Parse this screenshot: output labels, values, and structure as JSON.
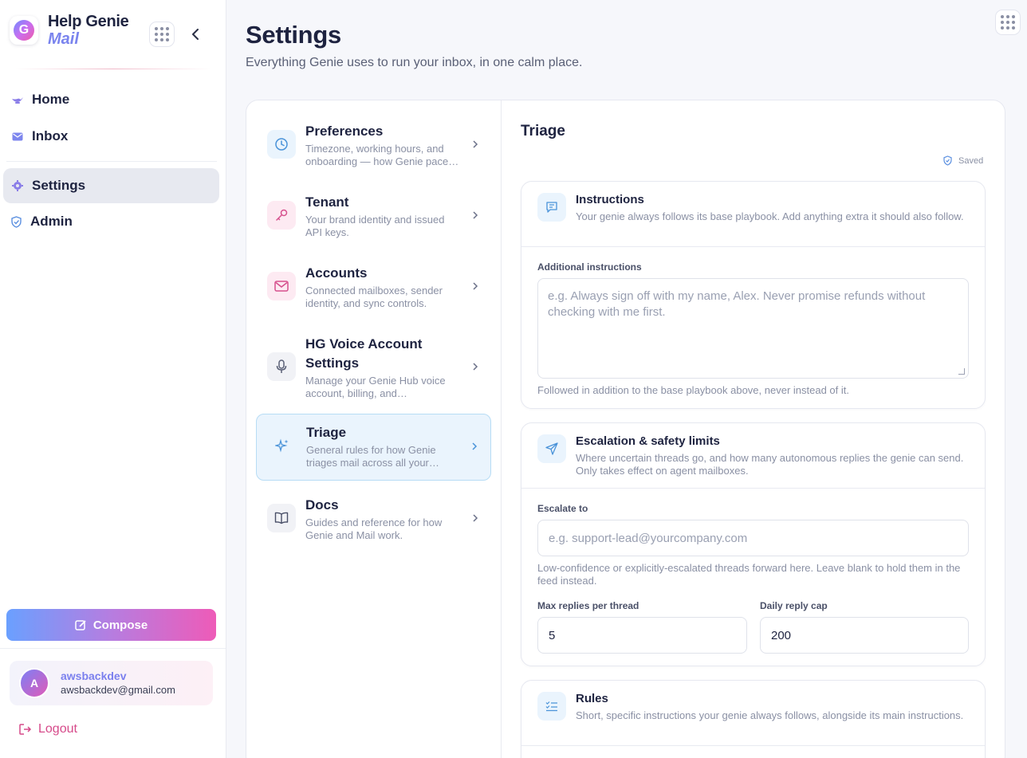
{
  "brand": {
    "name": "Help Genie",
    "sub": "Mail",
    "logo_letter": "G"
  },
  "nav": [
    {
      "label": "Home",
      "icon": "lamp-icon"
    },
    {
      "label": "Inbox",
      "icon": "mail-icon"
    },
    {
      "label": "Settings",
      "icon": "gear-icon",
      "active": true
    },
    {
      "label": "Admin",
      "icon": "shield-icon"
    }
  ],
  "compose_label": "Compose",
  "user": {
    "initial": "A",
    "name": "awsbackdev",
    "email": "awsbackdev@gmail.com"
  },
  "logout_label": "Logout",
  "page": {
    "title": "Settings",
    "subtitle": "Everything Genie uses to run your inbox, in one calm place."
  },
  "menu": [
    {
      "title": "Preferences",
      "desc": "Timezone, working hours, and onboarding — how Genie pace…",
      "icon": "clock-icon"
    },
    {
      "title": "Tenant",
      "desc": "Your brand identity and issued API keys.",
      "icon": "key-icon"
    },
    {
      "title": "Accounts",
      "desc": "Connected mailboxes, sender identity, and sync controls.",
      "icon": "mail-icon"
    },
    {
      "title": "HG Voice Account Settings",
      "desc": "Manage your Genie Hub voice account, billing, and…",
      "icon": "microphone-icon"
    },
    {
      "title": "Triage",
      "desc": "General rules for how Genie triages mail across all your…",
      "icon": "sparkles-icon",
      "active": true
    },
    {
      "title": "Docs",
      "desc": "Guides and reference for how Genie and Mail work.",
      "icon": "book-icon"
    }
  ],
  "detail": {
    "title": "Triage",
    "saved_label": "Saved",
    "instructions": {
      "title": "Instructions",
      "desc": "Your genie always follows its base playbook. Add anything extra it should also follow.",
      "field_label": "Additional instructions",
      "placeholder": "e.g. Always sign off with my name, Alex. Never promise refunds without checking with me first.",
      "hint": "Followed in addition to the base playbook above, never instead of it."
    },
    "escalation": {
      "title": "Escalation & safety limits",
      "desc": "Where uncertain threads go, and how many autonomous replies the genie can send. Only takes effect on agent mailboxes.",
      "escalate_label": "Escalate to",
      "escalate_placeholder": "e.g. support-lead@yourcompany.com",
      "escalate_hint": "Low-confidence or explicitly-escalated threads forward here. Leave blank to hold them in the feed instead.",
      "max_replies_label": "Max replies per thread",
      "max_replies_value": "5",
      "daily_cap_label": "Daily reply cap",
      "daily_cap_value": "200"
    },
    "rules": {
      "title": "Rules",
      "desc": "Short, specific instructions your genie always follows, alongside its main instructions."
    }
  }
}
